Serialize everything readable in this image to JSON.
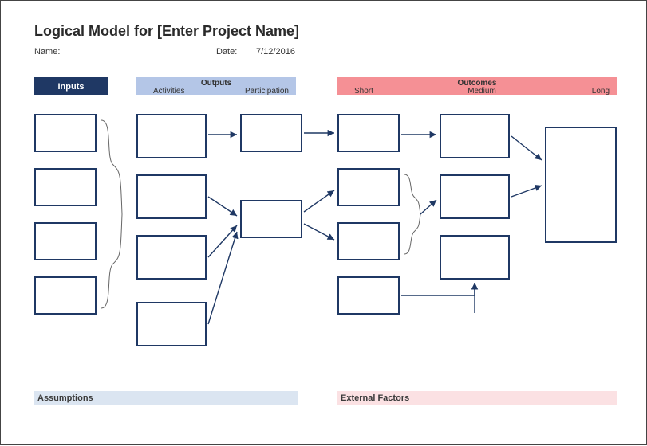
{
  "title": "Logical Model for [Enter Project Name]",
  "meta": {
    "name_label": "Name:",
    "date_label": "Date:",
    "date_value": "7/12/2016"
  },
  "headers": {
    "inputs": "Inputs",
    "outputs": {
      "title": "Outputs",
      "activities": "Activities",
      "participation": "Participation"
    },
    "outcomes": {
      "title": "Outcomes",
      "short": "Short",
      "medium": "Medium",
      "long": "Long"
    }
  },
  "footer": {
    "assumptions": "Assumptions",
    "external": "External Factors"
  },
  "colors": {
    "dark_blue": "#1f3864",
    "light_blue": "#b4c6e7",
    "salmon": "#f59095",
    "light_blue_soft": "#dbe5f1",
    "salmon_soft": "#fbe1e3"
  }
}
